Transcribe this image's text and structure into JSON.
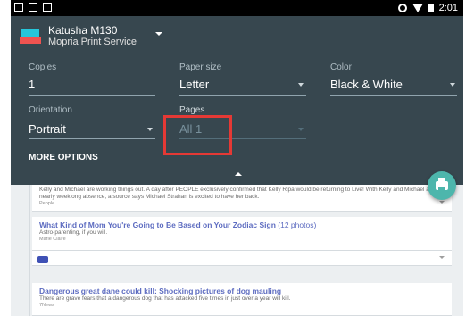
{
  "statusbar": {
    "time": "2:01"
  },
  "printer": {
    "name": "Katusha M130",
    "service": "Mopria Print Service",
    "logo_text": "mopria"
  },
  "fields": {
    "copies": {
      "label": "Copies",
      "value": "1"
    },
    "paper_size": {
      "label": "Paper size",
      "value": "Letter"
    },
    "color": {
      "label": "Color",
      "value": "Black & White"
    },
    "orientation": {
      "label": "Orientation",
      "value": "Portrait"
    },
    "pages": {
      "label": "Pages",
      "value": "All 1"
    }
  },
  "more_options": "MORE OPTIONS",
  "feed": {
    "items": [
      {
        "title": "",
        "text": "Kelly and Michael are working things out. A day after PEOPLE exclusively confirmed that Kelly Ripa would be returning to Live! With Kelly and Michael after a nearly weeklong absence, a source says Michael Strahan is excited to have her back.",
        "source": "People"
      },
      {
        "title": "What Kind of Mom You're Going to Be Based on Your Zodiac Sign",
        "count": "(12 photos)",
        "text": "Astro-parenting, if you will.",
        "source": "Marie Claire"
      },
      {
        "title": "Dangerous great dane could kill: Shocking pictures of dog mauling",
        "text": "There are grave fears that a dangerous dog that has attacked five times in just over a year will kill.",
        "source": "7News"
      }
    ]
  },
  "colors": {
    "panel": "#37474f",
    "fab": "#4db6ac",
    "highlight": "#e53935",
    "link": "#5c6bc0"
  }
}
